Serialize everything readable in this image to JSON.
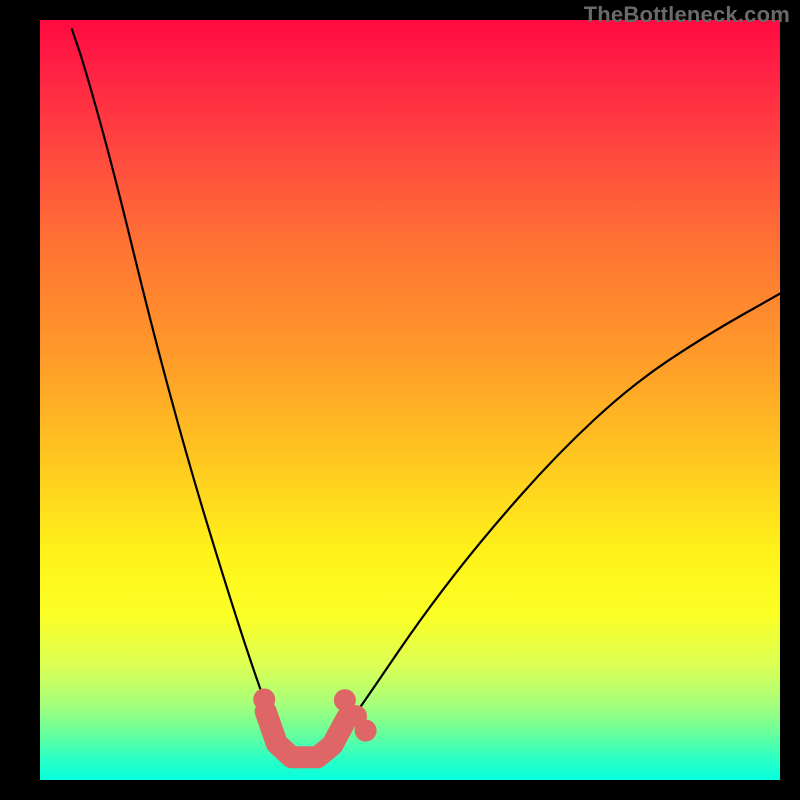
{
  "watermark": "TheBottleneck.com",
  "chart_data": {
    "type": "line",
    "title": "",
    "xlabel": "",
    "ylabel": "",
    "xlim": [
      0,
      100
    ],
    "ylim": [
      0,
      100
    ],
    "grid": false,
    "legend": false,
    "description": "Bottleneck-style V-curve on a vertical red→green gradient. One black curve descends steeply from the top-left, reaches a minimum around x≈35, then rises more gradually toward the upper right. Near the minimum a short salmon-colored U-shaped stroke with several salmon dots highlights the optimal region.",
    "series": [
      {
        "name": "curve",
        "points": [
          {
            "x": 4.3,
            "y": 98.8
          },
          {
            "x": 6,
            "y": 94
          },
          {
            "x": 10,
            "y": 80
          },
          {
            "x": 15,
            "y": 60
          },
          {
            "x": 20,
            "y": 42
          },
          {
            "x": 25,
            "y": 26
          },
          {
            "x": 29,
            "y": 14
          },
          {
            "x": 32,
            "y": 6
          },
          {
            "x": 34.5,
            "y": 2.2
          },
          {
            "x": 37,
            "y": 2.2
          },
          {
            "x": 40,
            "y": 5
          },
          {
            "x": 45,
            "y": 12
          },
          {
            "x": 52,
            "y": 22
          },
          {
            "x": 60,
            "y": 32
          },
          {
            "x": 70,
            "y": 43
          },
          {
            "x": 80,
            "y": 52
          },
          {
            "x": 90,
            "y": 58.5
          },
          {
            "x": 100,
            "y": 64
          }
        ]
      }
    ],
    "highlight": {
      "color": "#df6666",
      "u_path": [
        {
          "x": 30.5,
          "y": 9.0
        },
        {
          "x": 32.0,
          "y": 4.8
        },
        {
          "x": 34.0,
          "y": 3.0
        },
        {
          "x": 37.5,
          "y": 3.0
        },
        {
          "x": 39.5,
          "y": 4.6
        },
        {
          "x": 41.5,
          "y": 8.2
        }
      ],
      "dots": [
        {
          "x": 30.3,
          "y": 10.6
        },
        {
          "x": 41.2,
          "y": 10.5
        },
        {
          "x": 42.7,
          "y": 8.4
        },
        {
          "x": 44.0,
          "y": 6.5
        }
      ]
    }
  }
}
